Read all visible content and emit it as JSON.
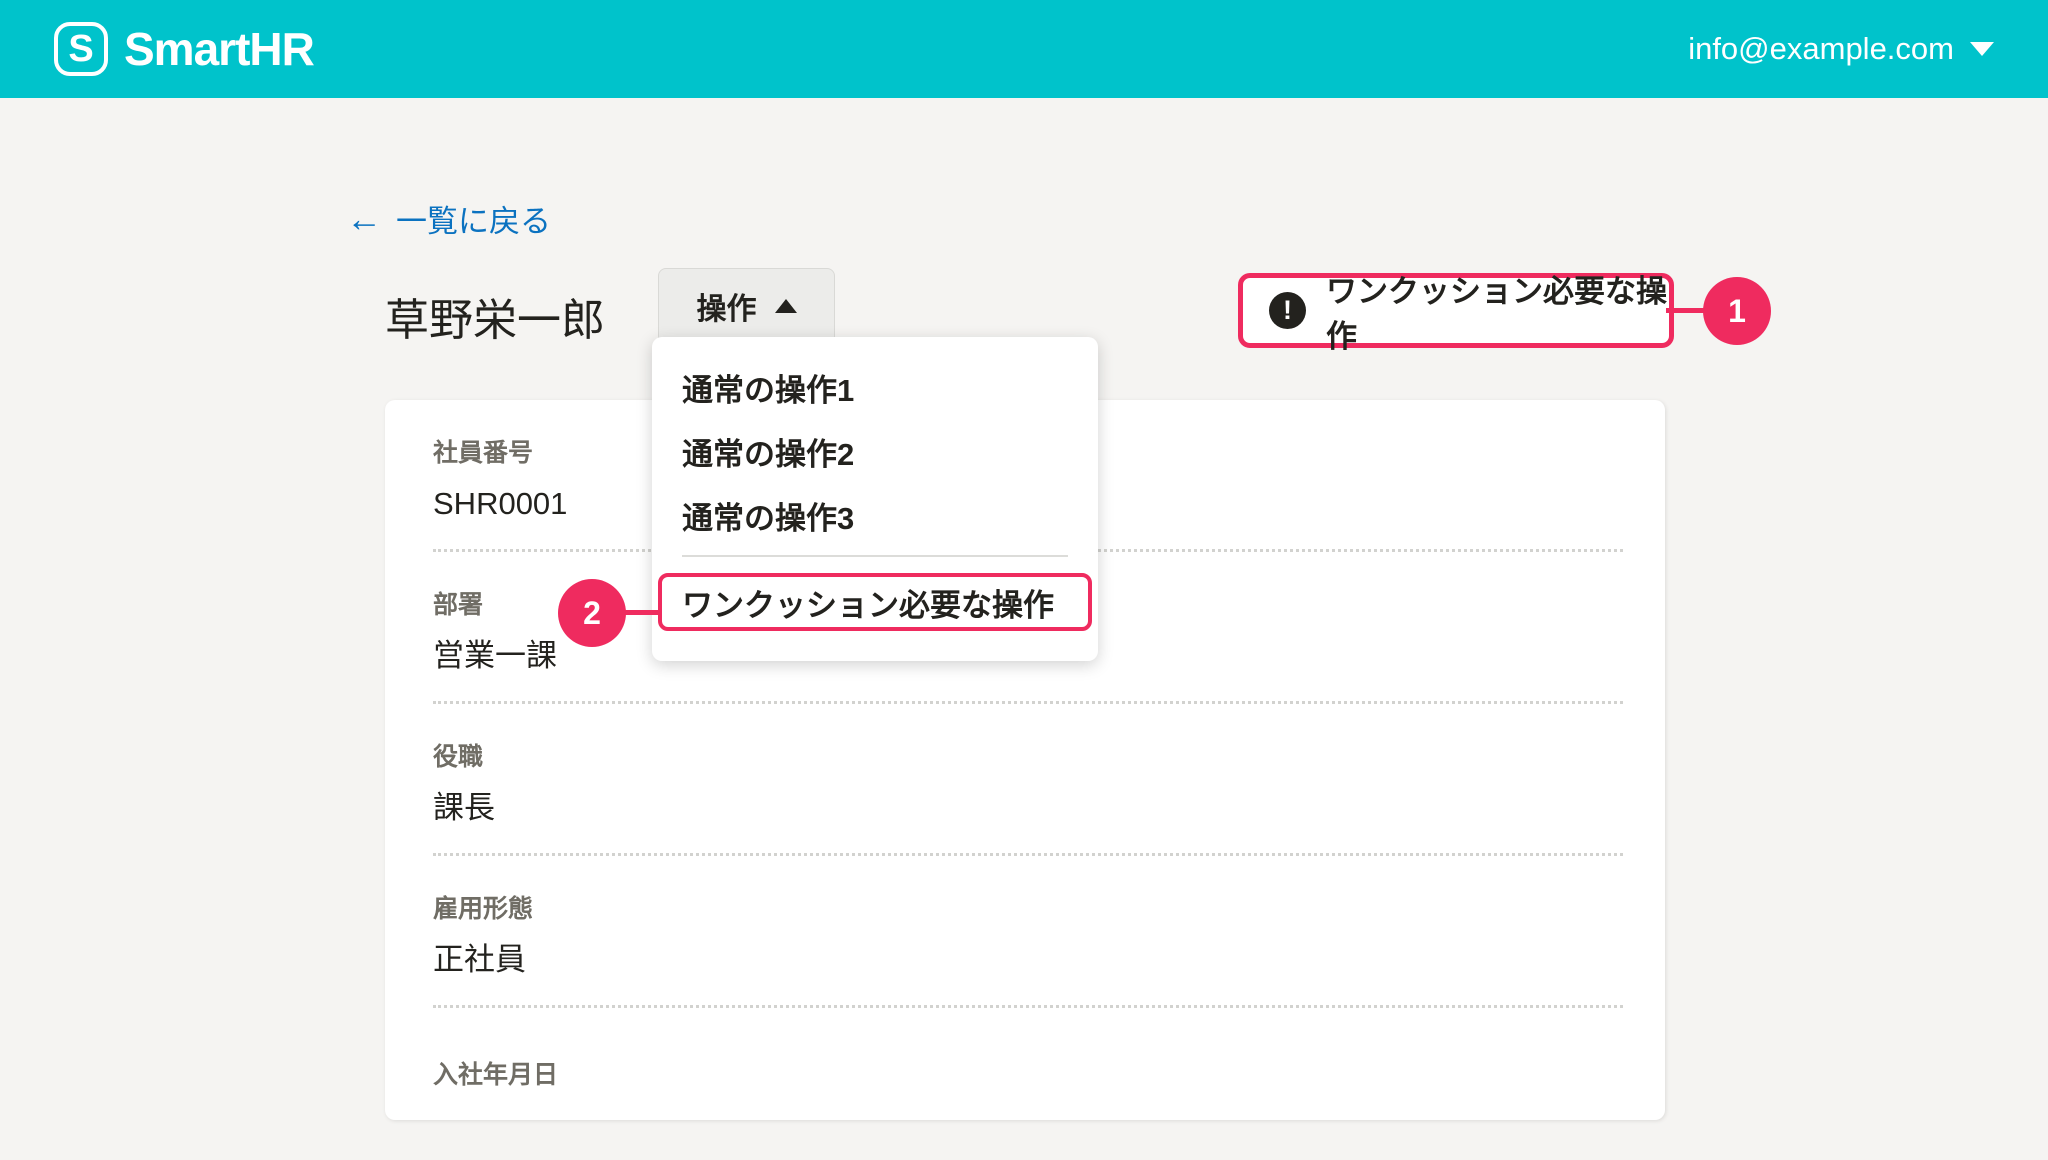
{
  "colors": {
    "brand_teal": "#00c3cb",
    "annotation_pink": "#ef2b5f",
    "link_blue": "#0b72c0",
    "text_black": "#23221e",
    "label_grey": "#706d65"
  },
  "header": {
    "brand": "SmartHR",
    "brand_initial": "S",
    "account_email": "info@example.com"
  },
  "page": {
    "back_arrow": "←",
    "back_link": "一覧に戻る",
    "title": "草野栄一郎"
  },
  "action_menu": {
    "button_label": "操作",
    "items": [
      {
        "label": "通常の操作1"
      },
      {
        "label": "通常の操作2"
      },
      {
        "label": "通常の操作3"
      }
    ],
    "highlighted_item": "ワンクッション必要な操作"
  },
  "annotations": {
    "callout1": {
      "number": "1",
      "icon_glyph": "!",
      "label": "ワンクッション必要な操作"
    },
    "callout2": {
      "number": "2"
    }
  },
  "profile_card": {
    "fields": [
      {
        "label": "社員番号",
        "value": "SHR0001"
      },
      {
        "label": "部署",
        "value": "営業一課"
      },
      {
        "label": "役職",
        "value": "課長"
      },
      {
        "label": "雇用形態",
        "value": "正社員"
      },
      {
        "label": "入社年月日",
        "value": ""
      }
    ]
  }
}
